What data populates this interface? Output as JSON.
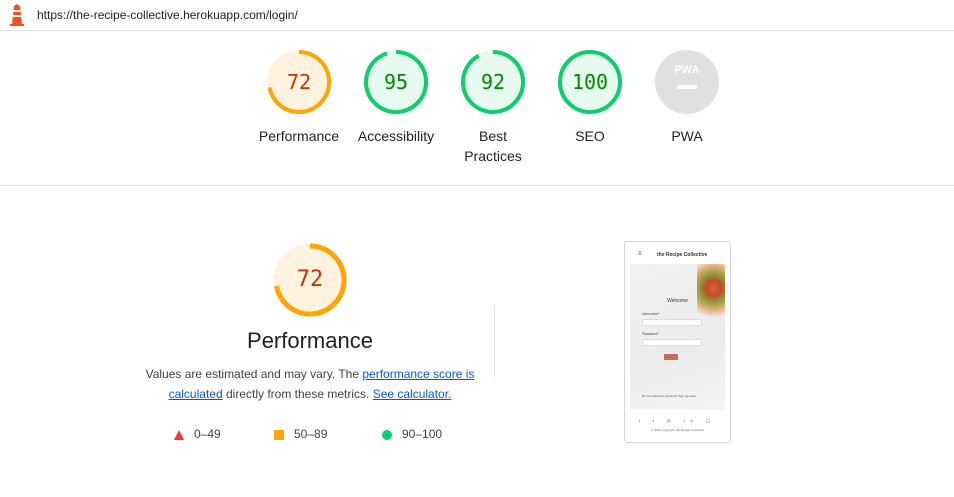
{
  "browser": {
    "url": "https://the-recipe-collective.herokuapp.com/login/"
  },
  "colors": {
    "average": "#ffa400",
    "average_bg": "#fff3e0",
    "average_text": "#c33300",
    "pass": "#0cce6b",
    "pass_bg": "#e6faef",
    "pass_text": "#008800",
    "fail": "#ff3333",
    "na": "#e0e0e0"
  },
  "gauges": [
    {
      "score": "72",
      "label": "Performance",
      "value": 0.72,
      "status": "average"
    },
    {
      "score": "95",
      "label": "Accessibility",
      "value": 0.95,
      "status": "pass"
    },
    {
      "score": "92",
      "label": "Best Practices",
      "value": 0.92,
      "status": "pass"
    },
    {
      "score": "100",
      "label": "SEO",
      "value": 1.0,
      "status": "pass"
    },
    {
      "score": "",
      "label": "PWA",
      "value": 0,
      "status": "na",
      "badge": "PWA"
    }
  ],
  "performance": {
    "score": "72",
    "value": 0.72,
    "title": "Performance",
    "desc_part1": "Values are estimated and may vary. The ",
    "link1": "performance score is calculated",
    "desc_part2": " directly from these metrics. ",
    "link2": "See calculator."
  },
  "legend": [
    {
      "range": "0–49",
      "shape": "triangle"
    },
    {
      "range": "50–89",
      "shape": "square"
    },
    {
      "range": "90–100",
      "shape": "circle"
    }
  ],
  "screenshot": {
    "brand": "the Recipe Collective",
    "welcome": "Welcome",
    "username_label": "Username*",
    "password_label": "Password*",
    "signup_note": "Do You Need An Account? Sign Up Here",
    "social": "f t ◎ in ◯",
    "copyright": "© 2021 Copyright: the Recipe Collective"
  }
}
